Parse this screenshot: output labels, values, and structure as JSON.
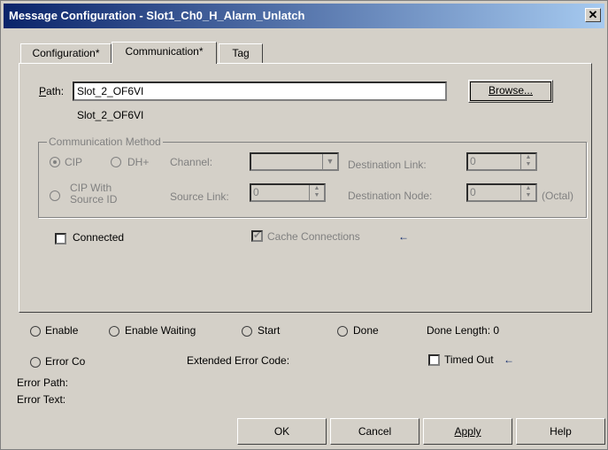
{
  "window": {
    "title": "Message Configuration - Slot1_Ch0_H_Alarm_Unlatch",
    "close_icon": "close-icon"
  },
  "tabs": [
    {
      "label": "Configuration*",
      "active": false
    },
    {
      "label": "Communication*",
      "active": true
    },
    {
      "label": "Tag",
      "active": false
    }
  ],
  "path": {
    "label_prefix": "P",
    "label_rest": "ath:",
    "value": "Slot_2_OF6VI",
    "resolved": "Slot_2_OF6VI",
    "browse_label": "Browse..."
  },
  "comm_method": {
    "group_label": "Communication Method",
    "cip_label": "CIP",
    "dhplus_label": "DH+",
    "cip_source_label_line1": "CIP With",
    "cip_source_label_line2": "Source ID",
    "channel_label": "Channel:",
    "channel_value": "",
    "destination_link_label": "Destination Link:",
    "destination_link_value": "0",
    "source_link_label": "Source Link:",
    "source_link_value": "0",
    "destination_node_label": "Destination Node:",
    "destination_node_value": "0",
    "octal_label": "(Octal)"
  },
  "connected": {
    "label": "Connected",
    "checked": false
  },
  "cache_connections": {
    "label": "Cache Connections",
    "checked": true
  },
  "status": {
    "enable": "Enable",
    "enable_waiting": "Enable Waiting",
    "start": "Start",
    "done": "Done",
    "done_length": "Done Length: 0",
    "error_code": "Error Co",
    "extended_error_code": "Extended Error Code:",
    "timed_out": "Timed Out",
    "error_path": "Error Path:",
    "error_text": "Error Text:"
  },
  "buttons": {
    "ok": "OK",
    "cancel": "Cancel",
    "apply": "Apply",
    "help": "Help"
  }
}
